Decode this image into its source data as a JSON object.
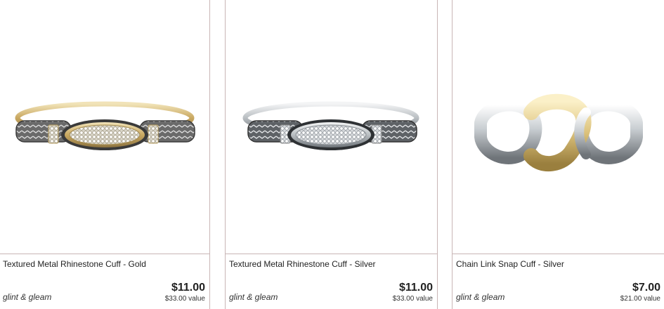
{
  "products": [
    {
      "title": "Textured Metal Rhinestone Cuff - Gold",
      "brand": "glint & gleam",
      "price": "$11.00",
      "value": "$33.00 value",
      "image": "gold-rhinestone-cuff-image"
    },
    {
      "title": "Textured Metal Rhinestone Cuff - Silver",
      "brand": "glint & gleam",
      "price": "$11.00",
      "value": "$33.00 value",
      "image": "silver-rhinestone-cuff-image"
    },
    {
      "title": "Chain Link Snap Cuff - Silver",
      "brand": "glint & gleam",
      "price": "$7.00",
      "value": "$21.00 value",
      "image": "chain-link-cuff-image"
    }
  ],
  "colors": {
    "border": "#c9b6b6",
    "gold": "#d8c48a",
    "silver": "#c8ccd0"
  }
}
